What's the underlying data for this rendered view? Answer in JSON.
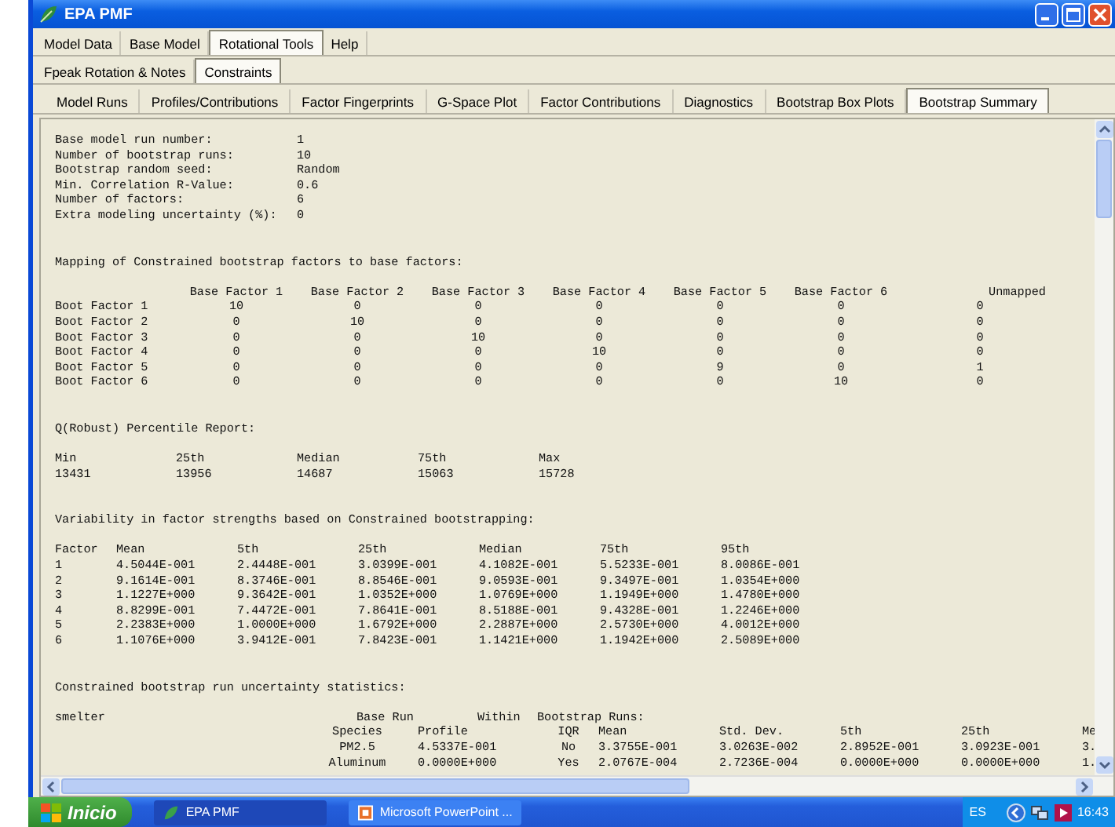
{
  "window": {
    "title": "EPA PMF"
  },
  "menu_tabs": [
    {
      "label": "Model Data",
      "selected": false
    },
    {
      "label": "Base Model",
      "selected": false
    },
    {
      "label": "Rotational Tools",
      "selected": true
    },
    {
      "label": "Help",
      "selected": false
    }
  ],
  "sub_tabs": [
    {
      "label": "Fpeak Rotation & Notes",
      "selected": false
    },
    {
      "label": "Constraints",
      "selected": true
    }
  ],
  "view_tabs": [
    {
      "label": "Model Runs",
      "selected": false
    },
    {
      "label": "Profiles/Contributions",
      "selected": false
    },
    {
      "label": "Factor Fingerprints",
      "selected": false
    },
    {
      "label": "G-Space Plot",
      "selected": false
    },
    {
      "label": "Factor Contributions",
      "selected": false
    },
    {
      "label": "Diagnostics",
      "selected": false
    },
    {
      "label": "Bootstrap Box Plots",
      "selected": false
    },
    {
      "label": "Bootstrap Summary",
      "selected": true
    }
  ],
  "report": {
    "settings": [
      {
        "label": "Base model run number:",
        "value": "1"
      },
      {
        "label": "Number of bootstrap runs:",
        "value": "10"
      },
      {
        "label": "Bootstrap random seed:",
        "value": "Random"
      },
      {
        "label": "Min. Correlation R-Value:",
        "value": "0.6"
      },
      {
        "label": "Number of factors:",
        "value": "6"
      },
      {
        "label": "Extra modeling uncertainty (%):",
        "value": "0"
      }
    ],
    "mapping": {
      "title": "Mapping of Constrained bootstrap factors to base factors:",
      "columns": [
        "Base Factor 1",
        "Base Factor 2",
        "Base Factor 3",
        "Base Factor 4",
        "Base Factor 5",
        "Base Factor 6",
        "Unmapped"
      ],
      "rows": [
        {
          "label": "Boot Factor 1",
          "values": [
            "10",
            "0",
            "0",
            "0",
            "0",
            "0",
            "0"
          ]
        },
        {
          "label": "Boot Factor 2",
          "values": [
            "0",
            "10",
            "0",
            "0",
            "0",
            "0",
            "0"
          ]
        },
        {
          "label": "Boot Factor 3",
          "values": [
            "0",
            "0",
            "10",
            "0",
            "0",
            "0",
            "0"
          ]
        },
        {
          "label": "Boot Factor 4",
          "values": [
            "0",
            "0",
            "0",
            "10",
            "0",
            "0",
            "0"
          ]
        },
        {
          "label": "Boot Factor 5",
          "values": [
            "0",
            "0",
            "0",
            "0",
            "9",
            "0",
            "1"
          ]
        },
        {
          "label": "Boot Factor 6",
          "values": [
            "0",
            "0",
            "0",
            "0",
            "0",
            "10",
            "0"
          ]
        }
      ]
    },
    "percentile": {
      "title": "Q(Robust) Percentile Report:",
      "columns": [
        "Min",
        "25th",
        "Median",
        "75th",
        "Max"
      ],
      "values": [
        "13431",
        "13956",
        "14687",
        "15063",
        "15728"
      ]
    },
    "variability": {
      "title": "Variability in factor strengths based on Constrained bootstrapping:",
      "columns": [
        "Factor",
        "Mean",
        "5th",
        "25th",
        "Median",
        "75th",
        "95th"
      ],
      "rows": [
        [
          "1",
          "4.5044E-001",
          "2.4448E-001",
          "3.0399E-001",
          "4.1082E-001",
          "5.5233E-001",
          "8.0086E-001"
        ],
        [
          "2",
          "9.1614E-001",
          "8.3746E-001",
          "8.8546E-001",
          "9.0593E-001",
          "9.3497E-001",
          "1.0354E+000"
        ],
        [
          "3",
          "1.1227E+000",
          "9.3642E-001",
          "1.0352E+000",
          "1.0769E+000",
          "1.1949E+000",
          "1.4780E+000"
        ],
        [
          "4",
          "8.8299E-001",
          "7.4472E-001",
          "7.8641E-001",
          "8.5188E-001",
          "9.4328E-001",
          "1.2246E+000"
        ],
        [
          "5",
          "2.2383E+000",
          "1.0000E+000",
          "1.6792E+000",
          "2.2887E+000",
          "2.5730E+000",
          "4.0012E+000"
        ],
        [
          "6",
          "1.1076E+000",
          "3.9412E-001",
          "7.8423E-001",
          "1.1421E+000",
          "1.1942E+000",
          "2.5089E+000"
        ]
      ]
    },
    "uncertainty": {
      "title": "Constrained bootstrap run uncertainty statistics:",
      "group": "smelter",
      "header": [
        "Base Run",
        "Within",
        "Bootstrap Runs:"
      ],
      "columns": [
        "Species",
        "Profile",
        "IQR",
        "Mean",
        "Std. Dev.",
        "5th",
        "25th",
        "Me"
      ],
      "rows": [
        [
          "PM2.5",
          "4.5337E-001",
          "No",
          "3.3755E-001",
          "3.0263E-002",
          "2.8952E-001",
          "3.0923E-001",
          "3."
        ],
        [
          "Aluminum",
          "0.0000E+000",
          "Yes",
          "2.0767E-004",
          "2.7236E-004",
          "0.0000E+000",
          "0.0000E+000",
          "1."
        ]
      ]
    }
  },
  "taskbar": {
    "start": "Inicio",
    "tasks": [
      {
        "label": "EPA PMF",
        "selected": true
      },
      {
        "label": "Microsoft PowerPoint ...",
        "selected": false
      }
    ],
    "language": "ES",
    "time": "16:43"
  }
}
